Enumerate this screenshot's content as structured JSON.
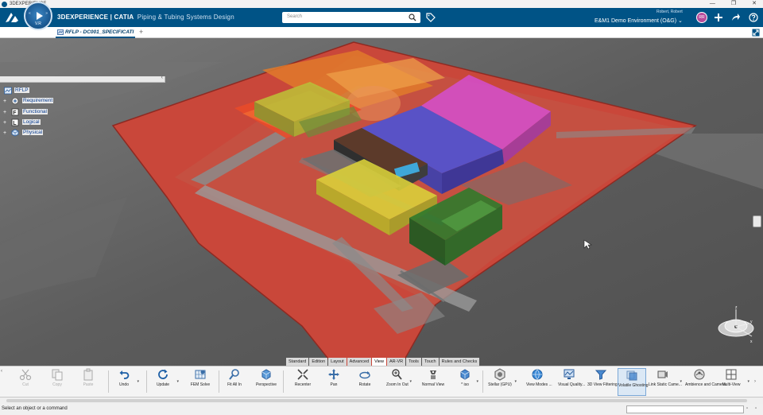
{
  "os": {
    "title": "3DEXPERIENCE",
    "controls": [
      "—",
      "❐",
      "✕"
    ]
  },
  "topbar": {
    "brand_bold": "3D",
    "brand_rest": "EXPERIENCE | CATIA",
    "app_name": "Piping & Tubing Systems Design",
    "compass_label": "V.R",
    "search_placeholder": "Search",
    "user_name": "Robert, Robert",
    "environment": "E&M1 Demo Environment (O&G)",
    "environment_chevron": "⌄",
    "avatar_initials": "RR"
  },
  "tabs": [
    {
      "label": "RFLP - DC001_SPECIFICATI"
    }
  ],
  "tab_add": "+",
  "tree_toggle": "‹",
  "tree": {
    "root": "RFLP",
    "items": [
      {
        "label": "Requirement"
      },
      {
        "label": "Functional"
      },
      {
        "label": "Logical"
      },
      {
        "label": "Physical"
      }
    ]
  },
  "action_tabs": [
    "Standard",
    "Edition",
    "Layout",
    "Advanced",
    "View",
    "AR-VR",
    "Tools",
    "Touch",
    "Rules and Checks"
  ],
  "active_action_tab": "View",
  "commands": [
    {
      "label": "Cut",
      "icon": "scissors-icon",
      "enabled": false
    },
    {
      "label": "Copy",
      "icon": "copy-icon",
      "enabled": false
    },
    {
      "label": "Paste",
      "icon": "paste-icon",
      "enabled": false
    },
    {
      "label": "Undo",
      "icon": "undo-icon",
      "enabled": true
    },
    {
      "label": "Update",
      "icon": "update-icon",
      "enabled": true
    },
    {
      "label": "FEM Solve",
      "icon": "fem-solve-icon",
      "enabled": true
    },
    {
      "label": "Fit All In",
      "icon": "fit-all-icon",
      "enabled": true
    },
    {
      "label": "Perspective",
      "icon": "perspective-cube-icon",
      "enabled": true
    },
    {
      "label": "Recenter",
      "icon": "recenter-icon",
      "enabled": true
    },
    {
      "label": "Pan",
      "icon": "pan-icon",
      "enabled": true
    },
    {
      "label": "Rotate",
      "icon": "rotate-icon",
      "enabled": true
    },
    {
      "label": "Zoom In Out",
      "icon": "zoom-icon",
      "enabled": true
    },
    {
      "label": "Normal View",
      "icon": "normal-view-icon",
      "enabled": true
    },
    {
      "label": "* iso",
      "icon": "iso-cube-icon",
      "enabled": true
    },
    {
      "label": "Stellar (GPU)",
      "icon": "stellar-icon",
      "enabled": true
    },
    {
      "label": "View Modes ...",
      "icon": "globe-icon",
      "enabled": true
    },
    {
      "label": "Visual Quality...",
      "icon": "visual-quality-icon",
      "enabled": true
    },
    {
      "label": "3D View Filtering",
      "icon": "view-filter-icon",
      "enabled": true
    },
    {
      "label": "Volatile Ghosting",
      "icon": "ghosting-icon",
      "enabled": true,
      "selected": true
    },
    {
      "label": "Link Static Came...",
      "icon": "camera-link-icon",
      "enabled": true
    },
    {
      "label": "Ambience and Camera",
      "icon": "ambience-camera-icon",
      "enabled": true
    },
    {
      "label": "Multi-View",
      "icon": "multi-view-icon",
      "enabled": true
    }
  ],
  "status": {
    "message": "Select an object or a command",
    "command_input": ""
  },
  "nav_ball": {
    "axis_z": "z",
    "axis_x": "x",
    "axis_y": "y"
  },
  "colors": {
    "brand_blue": "#005386",
    "site_red": "#c9473a",
    "zone_magenta": "#d44fd0",
    "zone_blue": "#4a52d8",
    "zone_yellow": "#d9cf3a",
    "zone_green": "#2f7a2c",
    "zone_orange": "#e07a2c"
  }
}
